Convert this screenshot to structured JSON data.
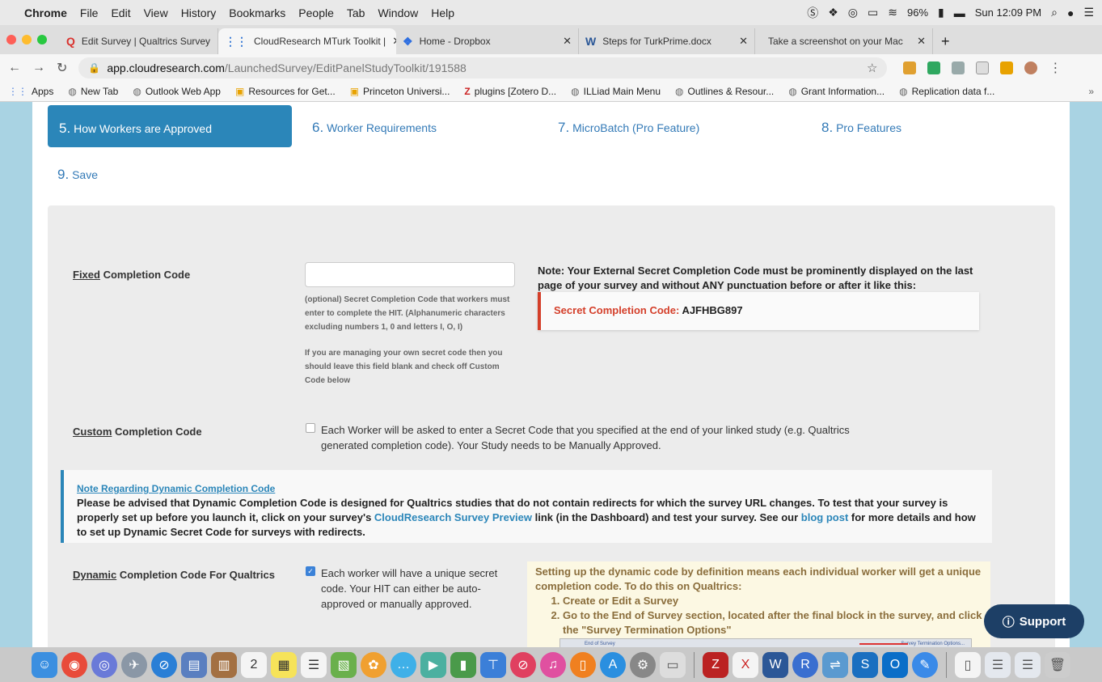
{
  "menubar": {
    "app": "Chrome",
    "items": [
      "File",
      "Edit",
      "View",
      "History",
      "Bookmarks",
      "People",
      "Tab",
      "Window",
      "Help"
    ],
    "battery": "96%",
    "clock": "Sun 12:09 PM"
  },
  "tabs": [
    {
      "label": "Edit Survey | Qualtrics Survey",
      "favicon": "Q",
      "color": "#d9302c",
      "active": false
    },
    {
      "label": "CloudResearch MTurk Toolkit |",
      "favicon": "⋮⋮",
      "color": "#3a7bd5",
      "active": true
    },
    {
      "label": "Home - Dropbox",
      "favicon": "❖",
      "color": "#2f6fe0",
      "active": false
    },
    {
      "label": "Steps for TurkPrime.docx",
      "favicon": "W",
      "color": "#2b5797",
      "active": false
    },
    {
      "label": "Take a screenshot on your Mac",
      "favicon": "",
      "color": "#333",
      "active": false
    }
  ],
  "address": {
    "host": "app.cloudresearch.com",
    "path": "/LaunchedSurvey/EditPanelStudyToolkit/191588"
  },
  "bookmarks": [
    "Apps",
    "New Tab",
    "Outlook Web App",
    "Resources for Get...",
    "Princeton Universi...",
    "plugins [Zotero D...",
    "ILLiad Main Menu",
    "Outlines & Resour...",
    "Grant Information...",
    "Replication data f..."
  ],
  "steps": {
    "s5": {
      "num": "5.",
      "label": "How Workers are Approved"
    },
    "s6": {
      "num": "6.",
      "label": "Worker Requirements"
    },
    "s7": {
      "num": "7.",
      "label": "MicroBatch (Pro Feature)"
    },
    "s8": {
      "num": "8.",
      "label": "Pro Features"
    },
    "s9": {
      "num": "9.",
      "label": "Save"
    }
  },
  "fixed": {
    "label_u": "Fixed",
    "label_rest": " Completion Code",
    "help1": "(optional) Secret Completion Code that workers must enter to complete the HIT. (Alphanumeric characters excluding numbers 1, 0 and letters I, O, I)",
    "help2": "If you are managing your own secret code then you should leave this field blank and check off Custom Code below",
    "note": "Note: Your External Secret Completion Code must be prominently displayed on the last page of your survey and without ANY punctuation before or after it like this:",
    "example_label": "Secret Completion Code:",
    "example_code": "AJFHBG897"
  },
  "custom": {
    "label_u": "Custom",
    "label_rest": " Completion Code",
    "checked": false,
    "text": "Each Worker will be asked to enter a Secret Code that you specified at the end of your linked study (e.g. Qualtrics generated completion code). Your Study needs to be Manually Approved."
  },
  "dynnote": {
    "title": "Note Regarding Dynamic Completion Code",
    "p1": "Please be advised that Dynamic Completion Code is designed for Qualtrics studies that do not contain redirects for which the survey URL changes. To test that your survey is properly set up before you launch it, click on your survey's ",
    "link1": "CloudResearch Survey Preview",
    "p2": " link (in the Dashboard) and test your survey. See our ",
    "link2": "blog post",
    "p3": " for more details and how to set up Dynamic Secret Code for surveys with redirects."
  },
  "dynamic": {
    "label_u": "Dynamic",
    "label_rest": " Completion Code For Qualtrics",
    "checked": true,
    "text": "Each worker will have a unique secret code. Your HIT can either be auto-approved or manually approved.",
    "info": "Setting up the dynamic code by definition means each individual worker will get a unique completion code. To do this on Qualtrics:",
    "step1": "Create or Edit a Survey",
    "step2": "Go to the End of Survey section, located after the final block in the survey, and click the \"Survey Termination Options\"",
    "mini_left": "End of Survey",
    "mini_right": "Survey Termination Options..."
  },
  "support_label": "Support"
}
